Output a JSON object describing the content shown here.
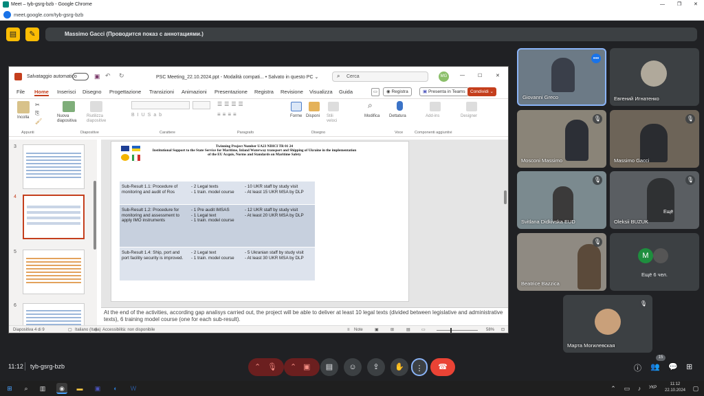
{
  "chrome": {
    "title": "Meet – tyb-gsrg-bzb - Google Chrome",
    "url": "meet.google.com/tyb-gsrg-bzb"
  },
  "meet": {
    "presenter_text": "Massimo Gacci (Проводится показ с аннотациями.)",
    "time": "11:12",
    "meeting_code": "tyb-gsrg-bzb",
    "people_count": "15",
    "more_people": "Ещё 6 чел.",
    "more_label": "Ещё"
  },
  "ppt": {
    "autosave": "Salvataggio automatico",
    "filename": "PSC Meeting_22.10.2024.ppt  -  Modalità compati...  •  Salvato in questo PC  ⌄",
    "search": "Cerca",
    "user_initials": "MG",
    "menu": [
      "File",
      "Home",
      "Inserisci",
      "Disegno",
      "Progettazione",
      "Transizioni",
      "Animazioni",
      "Presentazione",
      "Registra",
      "Revisione",
      "Visualizza",
      "Guida"
    ],
    "registra_btn": "Registra",
    "teams_btn": "Presenta in Teams",
    "share_btn": "Condividi ⌄",
    "ribbon": {
      "incolla": "Incolla",
      "nuova": "Nuova diapositiva",
      "riutilizza": "Riutilizza diapositive",
      "forme": "Forme",
      "disponi": "Disponi",
      "stili": "Stili veloci",
      "modifica": "Modifica",
      "dettatura": "Dettatura",
      "addin": "Add-ins",
      "designer": "Designer",
      "groups": [
        "Appunti",
        "Diapositive",
        "Carattere",
        "Paragrafo",
        "Disegno",
        "Voce",
        "Componenti aggiuntivi"
      ]
    },
    "thumb_numbers": [
      "3",
      "4",
      "5",
      "6"
    ],
    "slide": {
      "header": "Twinning Project Number UA23 NDICI TR 01 24\nInstitutional Support to the State Service for Maritime, Inland Waterway transport and Shipping of Ukraine in the implementation of the EU Acquis, Norms and Standards on Maritime Safety",
      "rows": [
        {
          "a": "Sub-Result 1.1: Procedure of monitoring and audit of Ros",
          "b": "- 2 Legal texts\n- 1 train. model course",
          "c": "- 10 UKR staff by study visit\n- At least 15 UKR MSA by DLP"
        },
        {
          "a": "Sub-Result 1.2: Procedure for monitoring and assessment to apply IMO instruments",
          "b": "- 1 Pre audit IMSAS\n- 1 Legal text\n- 1 train. model course",
          "c": "- 12 UKR staff by study visit\n- At least 20 UKR MSA by DLP"
        },
        {
          "a": "Sub-Result 1.4: Ship, port and port facility security is improved.",
          "b": "- 2 Legal text\n- 1 train. model course",
          "c": "- 5 Ukranian staff by study visit\n- At least 30 UKR MSA by DLP"
        }
      ]
    },
    "notes": "At the end of the activities, according gap analisys carried out, the project will be able to deliver at least 10 legal texts (divided between legislative and administrative texts), 6 training model course (one for each sub-result).",
    "status": {
      "slide": "Diapositiva 4 di 9",
      "lang": "Italiano (Italia)",
      "access": "Accessibilità: non disponibile",
      "note": "Note",
      "zoom": "58%"
    }
  },
  "participants": [
    {
      "name": "Giovanni Greco",
      "color": "#6c7a86"
    },
    {
      "name": "Евгений Игнатенко",
      "color": "#3c4043"
    },
    {
      "name": "Mosconi Massimo",
      "color": "#8a8478"
    },
    {
      "name": "Massimo Gacci",
      "color": "#6d6458"
    },
    {
      "name": "Svitlana Didkivska EUD",
      "color": "#7b8a8f"
    },
    {
      "name": "Oleksii BUZUK",
      "color": "#5a5e62"
    },
    {
      "name": "Beatrice Bazzica",
      "color": "#8f8a82"
    },
    {
      "name": "Марта Могилевская",
      "color": "#3c4043"
    }
  ],
  "taskbar": {
    "lang": "УКР",
    "time": "11:12",
    "date": "22.10.2024"
  },
  "colors": {
    "meet_bg": "#202124",
    "end_call": "#ea4335",
    "ppt_accent": "#c43e1c",
    "presenter_icon": "#fbbc04"
  }
}
